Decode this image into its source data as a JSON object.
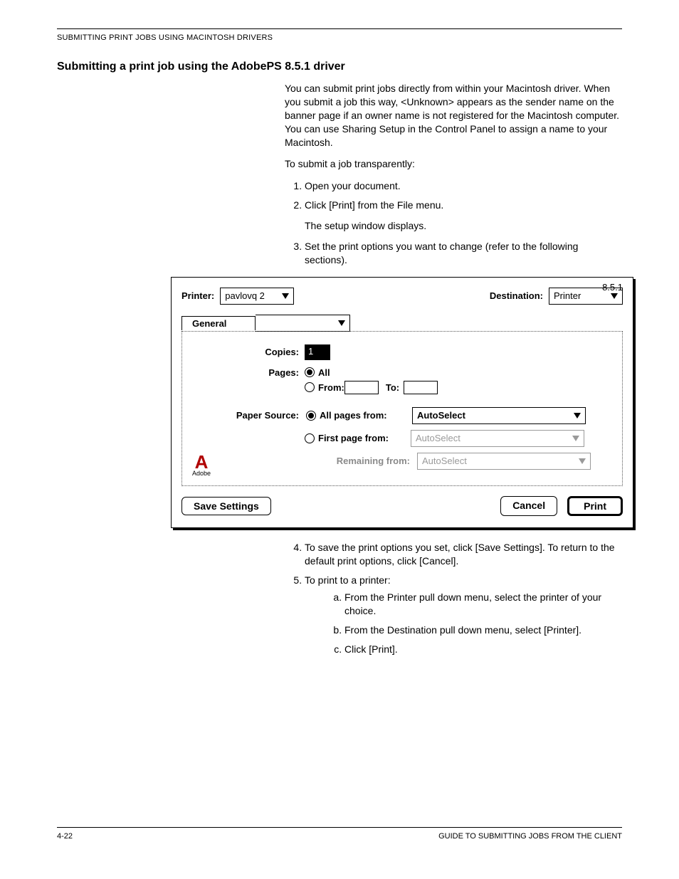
{
  "running_head": "SUBMITTING PRINT JOBS USING MACINTOSH DRIVERS",
  "section_title": "Submitting a print job using the AdobePS 8.5.1 driver",
  "intro_para": "You can submit print jobs directly from within your Macintosh driver. When you submit a job this way, <Unknown> appears as the sender name on the banner page if an owner name is not registered for the Macintosh computer. You can use Sharing Setup in the Control Panel to assign a name to your Macintosh.",
  "lead_in": "To submit a job transparently:",
  "steps_a": {
    "s1": "Open your document.",
    "s2": "Click [Print] from the File menu.",
    "s2_note": "The setup window displays.",
    "s3": "Set the print options you want to change (refer to the following sections)."
  },
  "dialog": {
    "version": "8.5.1",
    "printer_label": "Printer:",
    "printer_value": "pavlovq 2",
    "destination_label": "Destination:",
    "destination_value": "Printer",
    "panel_selected": "General",
    "copies_label": "Copies:",
    "copies_value": "1",
    "pages_label": "Pages:",
    "pages_all": "All",
    "pages_from_label": "From:",
    "pages_to_label": "To:",
    "papersource_label": "Paper Source:",
    "ps_all_label": "All pages from:",
    "ps_all_value": "AutoSelect",
    "ps_first_label": "First page from:",
    "ps_first_value": "AutoSelect",
    "ps_remaining_label": "Remaining from:",
    "ps_remaining_value": "AutoSelect",
    "adobe_caption": "Adobe",
    "save_settings": "Save Settings",
    "cancel": "Cancel",
    "print": "Print"
  },
  "steps_b": {
    "s4": "To save the print options you set, click [Save Settings]. To return to the default print options, click [Cancel].",
    "s5": "To print to a printer:",
    "s5a": "From the Printer pull down menu, select the printer of your choice.",
    "s5b": "From the Destination pull down menu, select [Printer].",
    "s5c": "Click [Print]."
  },
  "footer_left": "4-22",
  "footer_right": "GUIDE TO SUBMITTING JOBS FROM THE CLIENT"
}
